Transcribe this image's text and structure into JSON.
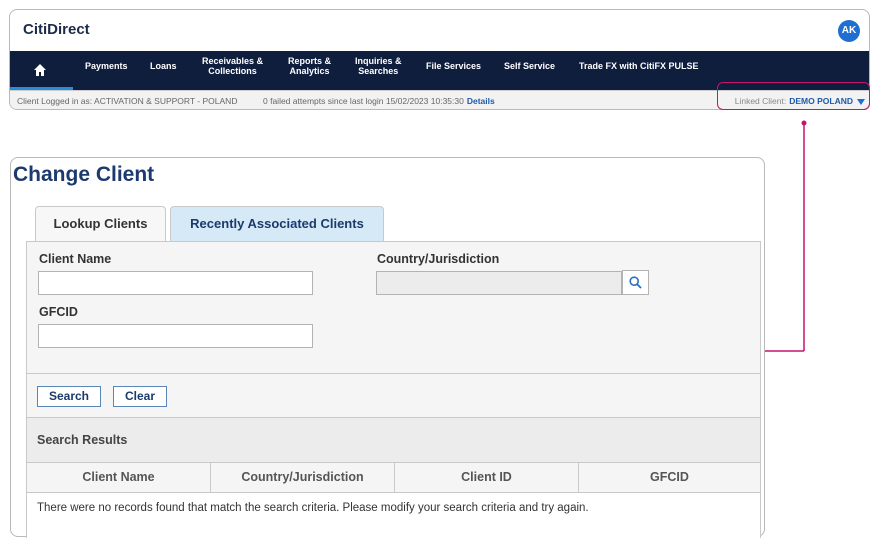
{
  "header": {
    "brand": "CitiDirect",
    "avatar_initials": "AK"
  },
  "nav": {
    "items": [
      {
        "label": "Payments"
      },
      {
        "label": "Loans"
      },
      {
        "label": "Receivables &\nCollections"
      },
      {
        "label": "Reports &\nAnalytics"
      },
      {
        "label": "Inquiries &\nSearches"
      },
      {
        "label": "File Services"
      },
      {
        "label": "Self Service"
      },
      {
        "label": "Trade FX with CitiFX PULSE"
      }
    ]
  },
  "status": {
    "logged_in": "Client Logged in as: ACTIVATION & SUPPORT - POLAND",
    "failed_attempts": "0 failed attempts since last login 15/02/2023 10:35:30",
    "details_link": "Details",
    "linked_client_label": "Linked Client:",
    "linked_client_value": "DEMO POLAND"
  },
  "panel": {
    "title": "Change Client",
    "tabs": [
      {
        "label": "Lookup Clients",
        "active": true
      },
      {
        "label": "Recently Associated Clients",
        "active": false
      }
    ],
    "form": {
      "client_name_label": "Client Name",
      "client_name_value": "",
      "country_label": "Country/Jurisdiction",
      "country_value": "",
      "gfcid_label": "GFCID",
      "gfcid_value": ""
    },
    "buttons": {
      "search": "Search",
      "clear": "Clear"
    },
    "results": {
      "title": "Search Results",
      "columns": [
        "Client Name",
        "Country/Jurisdiction",
        "Client ID",
        "GFCID"
      ],
      "empty_message": "There were no records found that match the search criteria. Please modify your search criteria and try again."
    }
  },
  "colors": {
    "nav_bg": "#0f1e3d",
    "accent": "#1f6fd0",
    "annotation": "#c8136f",
    "title": "#1c3a6d"
  },
  "icons": {
    "home": "home-icon",
    "search": "search-icon",
    "dropdown": "caret-down-icon"
  }
}
